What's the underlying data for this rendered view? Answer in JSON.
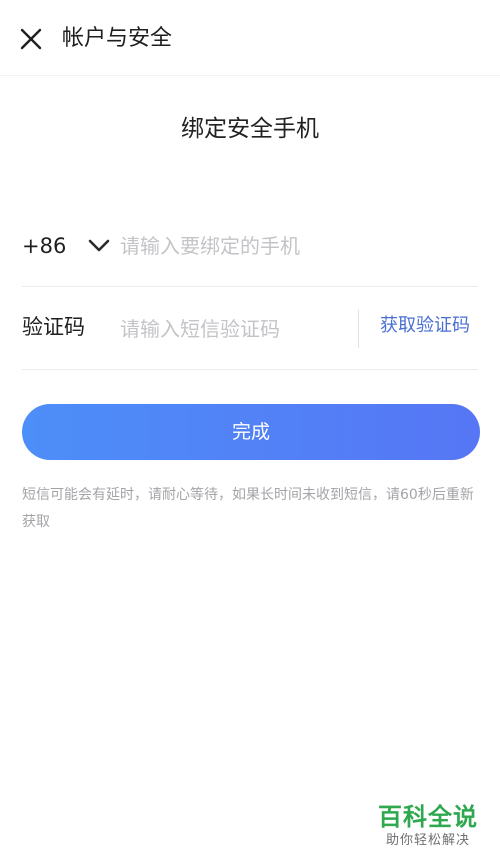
{
  "header": {
    "close_icon": "close-icon",
    "title": "帐户与安全"
  },
  "page_heading": "绑定安全手机",
  "phone_row": {
    "country_code": "+86",
    "dropdown_icon": "chevron-down-icon",
    "value": "",
    "placeholder": "请输入要绑定的手机"
  },
  "code_row": {
    "label": "验证码",
    "value": "",
    "placeholder": "请输入短信验证码",
    "get_code_label": "获取验证码"
  },
  "submit_label": "完成",
  "hint": "短信可能会有延时，请耐心等待，如果长时间未收到短信，请60秒后重新获取",
  "watermark": {
    "main": "百科全说",
    "sub": "助你轻松解决"
  },
  "colors": {
    "accent": "#4a6fd3",
    "button_gradient_start": "#4d8ef8",
    "button_gradient_end": "#5676f5",
    "watermark_green": "#2fa84f"
  }
}
